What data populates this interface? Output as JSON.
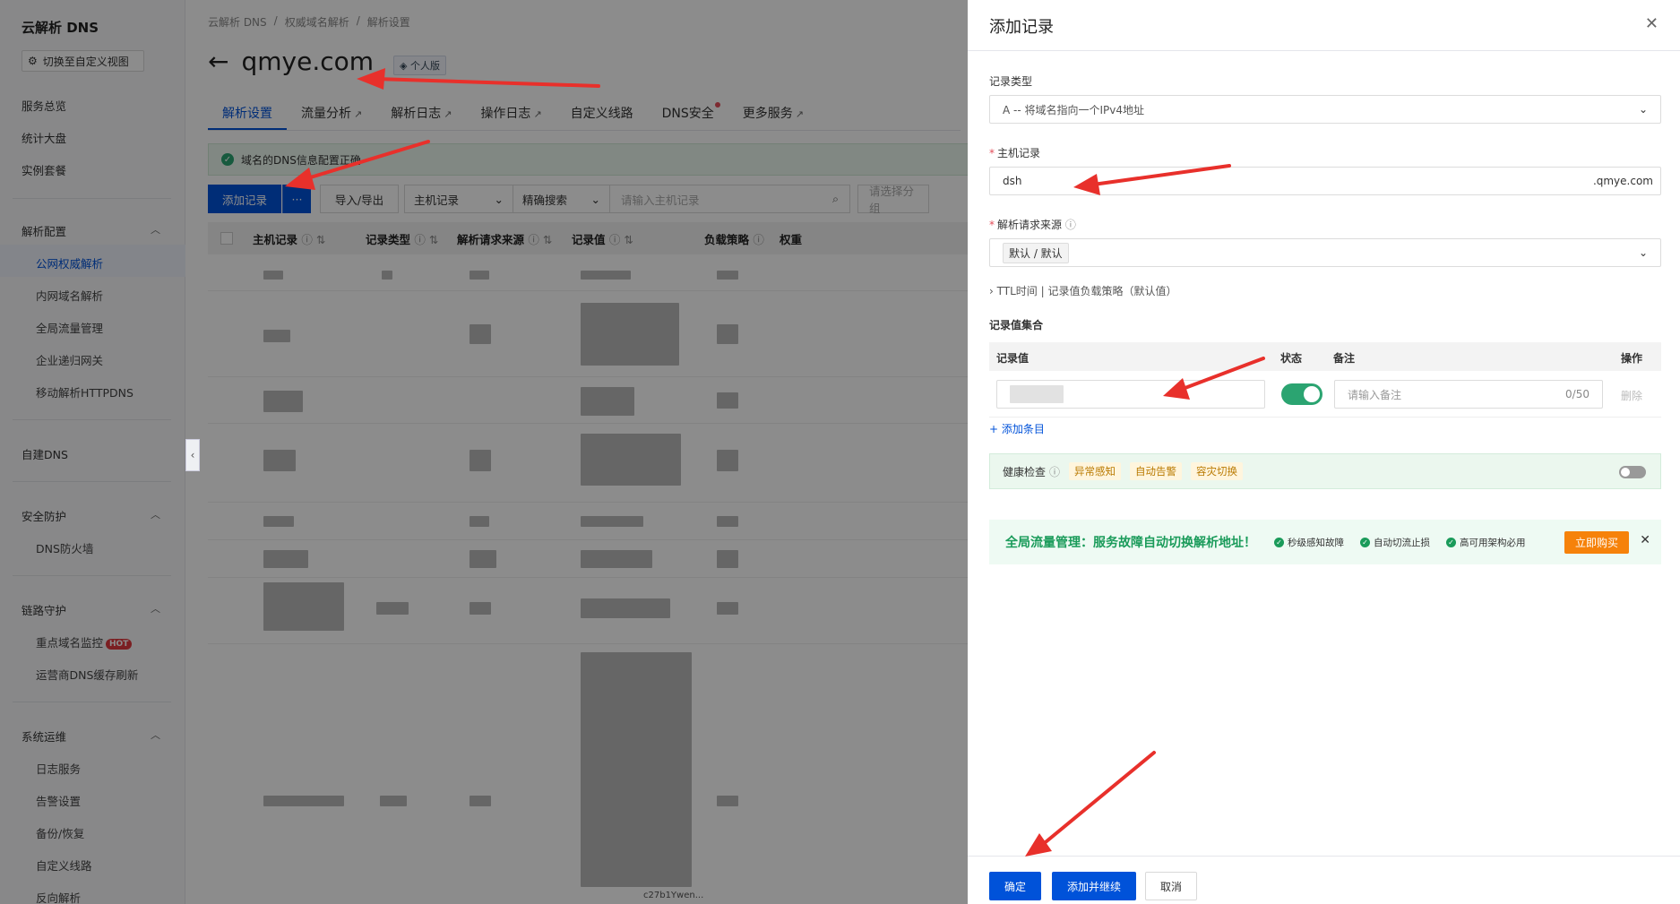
{
  "sidebar": {
    "title": "云解析 DNS",
    "switch_label": "切换至自定义视图",
    "items": [
      "服务总览",
      "统计大盘",
      "实例套餐"
    ],
    "groups": [
      {
        "label": "解析配置",
        "subs": [
          "公网权威解析",
          "内网域名解析",
          "全局流量管理",
          "企业递归网关",
          "移动解析HTTPDNS"
        ]
      },
      {
        "label": "自建DNS"
      },
      {
        "label": "安全防护",
        "subs": [
          "DNS防火墙"
        ]
      },
      {
        "label": "链路守护",
        "subs": [
          "重点域名监控",
          "运营商DNS缓存刷新"
        ]
      },
      {
        "label": "系统运维",
        "subs": [
          "日志服务",
          "告警设置",
          "备份/恢复",
          "自定义线路",
          "反向解析"
        ]
      }
    ],
    "hot": "HOT"
  },
  "main": {
    "breadcrumb": [
      "云解析 DNS",
      "/",
      "权威域名解析",
      "/",
      "解析设置"
    ],
    "domain": "qmye.com",
    "badge": "个人版",
    "tabs": [
      "解析设置",
      "流量分析",
      "解析日志",
      "操作日志",
      "自定义线路",
      "DNS安全",
      "更多服务"
    ],
    "notice": "域名的DNS信息配置正确",
    "toolbar": {
      "add": "添加记录",
      "more": "···",
      "import": "导入/导出",
      "host_select": "主机记录",
      "exact": "精确搜索",
      "search_placeholder": "请输入主机记录",
      "group_placeholder": "请选择分组"
    },
    "columns": [
      "主机记录",
      "记录类型",
      "解析请求来源",
      "记录值",
      "负载策略",
      "权重"
    ],
    "partial_value": "c27b1Ywen..."
  },
  "drawer": {
    "title": "添加记录",
    "record_type_label": "记录类型",
    "record_type_value": "A -- 将域名指向一个IPv4地址",
    "host_label": "主机记录",
    "host_value": "dsh",
    "host_suffix": ".qmye.com",
    "source_label": "解析请求来源",
    "source_tag": "默认 / 默认",
    "ttl_line": "TTL时间 | 记录值负载策略（默认值）",
    "values_label": "记录值集合",
    "vt_headers": {
      "value": "记录值",
      "status": "状态",
      "note": "备注",
      "op": "操作"
    },
    "note_placeholder": "请输入备注",
    "note_count": "0/50",
    "delete": "删除",
    "add_item": "+ 添加条目",
    "health_label": "健康检查",
    "health_tags": [
      "异常感知",
      "自动告警",
      "容灾切换"
    ],
    "promo_main": "全局流量管理：服务故障自动切换解析地址！",
    "promo_feats": [
      "秒级感知故障",
      "自动切流止损",
      "高可用架构必用"
    ],
    "promo_buy": "立即购买",
    "confirm": "确定",
    "add_continue": "添加并继续",
    "cancel": "取消"
  },
  "colors": {
    "primary": "#0052d9",
    "success": "#2ba471",
    "warning": "#f6820a",
    "arrow": "#e8302b"
  }
}
